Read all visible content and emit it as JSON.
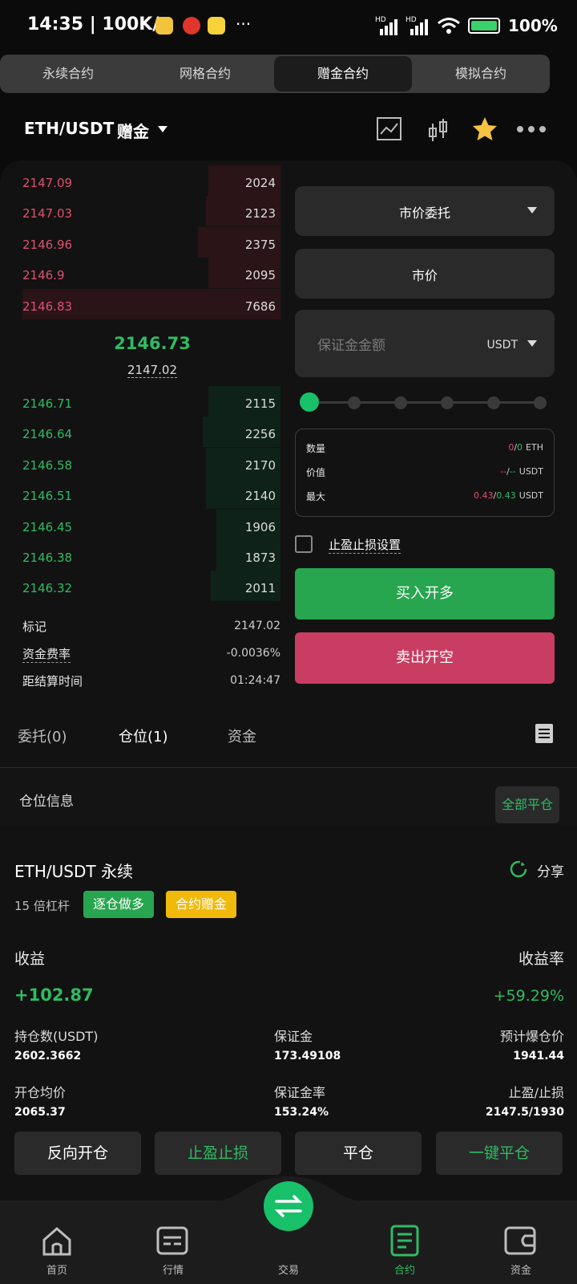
{
  "status_bar": {
    "time": "14:35 | 100K/s",
    "dots": "···",
    "battery": "100%",
    "net_hd1": "HD",
    "net_hd2": "HD"
  },
  "contract_tabs": [
    "永续合约",
    "网格合约",
    "赠金合约",
    "模拟合约"
  ],
  "active_tab_index": 2,
  "pair": {
    "symbol": "ETH/USDT",
    "type": "赠金"
  },
  "orderbook": {
    "asks": [
      {
        "price": "2147.09",
        "qty": "2024",
        "depth": 0.28
      },
      {
        "price": "2147.03",
        "qty": "2123",
        "depth": 0.29
      },
      {
        "price": "2146.96",
        "qty": "2375",
        "depth": 0.32
      },
      {
        "price": "2146.9",
        "qty": "2095",
        "depth": 0.28
      },
      {
        "price": "2146.83",
        "qty": "7686",
        "depth": 1.0
      }
    ],
    "last_price": "2146.73",
    "mark_price_small": "2147.02",
    "bids": [
      {
        "price": "2146.71",
        "qty": "2115",
        "depth": 0.28
      },
      {
        "price": "2146.64",
        "qty": "2256",
        "depth": 0.3
      },
      {
        "price": "2146.58",
        "qty": "2170",
        "depth": 0.29
      },
      {
        "price": "2146.51",
        "qty": "2140",
        "depth": 0.29
      },
      {
        "price": "2146.45",
        "qty": "1906",
        "depth": 0.25
      },
      {
        "price": "2146.38",
        "qty": "1873",
        "depth": 0.25
      },
      {
        "price": "2146.32",
        "qty": "2011",
        "depth": 0.27
      }
    ],
    "stats": [
      {
        "label": "标记",
        "value": "2147.02"
      },
      {
        "label": "资金费率",
        "value": "-0.0036%"
      },
      {
        "label": "距结算时间",
        "value": "01:24:47"
      }
    ]
  },
  "order_form": {
    "order_type": "市价委托",
    "price_label": "市价",
    "margin_placeholder": "保证金金额",
    "margin_unit": "USDT",
    "slider_value": 0,
    "info": [
      {
        "label": "数量",
        "a": "0",
        "sep": "/",
        "b": "0",
        "unit": "ETH"
      },
      {
        "label": "价值",
        "a": "--",
        "sep": "/",
        "b": "--",
        "unit": "USDT"
      },
      {
        "label": "最大",
        "a": "0.43",
        "sep": "/",
        "b": "0.43",
        "unit": "USDT"
      }
    ],
    "tpsl_label": "止盈止损设置",
    "buy_label": "买入开多",
    "sell_label": "卖出开空"
  },
  "position_tabs": [
    "委托(0)",
    "仓位(1)",
    "资金"
  ],
  "active_position_tab": 1,
  "position_header": {
    "title": "仓位信息",
    "close_all": "全部平仓"
  },
  "position": {
    "symbol": "ETH/USDT 永续",
    "share": "分享",
    "leverage": "15 倍杠杆",
    "badge_mode": "逐仓做多",
    "badge_bonus": "合约赠金",
    "pnl_label": "收益",
    "pnl_value": "+102.87",
    "roe_label": "收益率",
    "roe_value": "+59.29%",
    "fields": [
      {
        "label": "持仓数(USDT)",
        "value": "2602.3662"
      },
      {
        "label": "保证金",
        "value": "173.49108"
      },
      {
        "label": "预计爆仓价",
        "value": "1941.44"
      },
      {
        "label": "开仓均价",
        "value": "2065.37"
      },
      {
        "label": "保证金率",
        "value": "153.24%"
      },
      {
        "label": "止盈/止损",
        "value": "2147.5/1930"
      }
    ],
    "actions": [
      "反向开仓",
      "止盈止损",
      "平仓",
      "一键平仓"
    ]
  },
  "bottom_nav": [
    {
      "label": "首页",
      "icon": "home-icon"
    },
    {
      "label": "行情",
      "icon": "market-icon"
    },
    {
      "label": "交易",
      "icon": "swap-icon"
    },
    {
      "label": "合约",
      "icon": "contract-icon"
    },
    {
      "label": "资金",
      "icon": "wallet-icon"
    }
  ],
  "active_nav_index": 3,
  "colors": {
    "green": "#2fbb63",
    "red": "#e0506e",
    "buy": "#27a54f",
    "sell": "#c93d62",
    "yellow": "#f0b90b"
  }
}
